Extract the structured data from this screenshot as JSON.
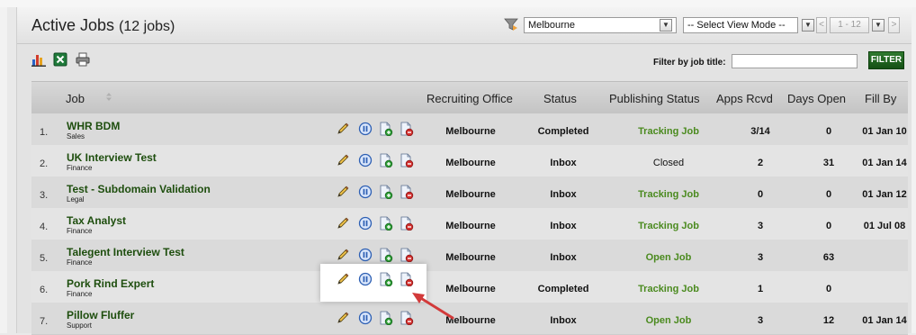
{
  "header": {
    "title": "Active Jobs",
    "count": "(12 jobs)"
  },
  "office_filter": {
    "selected": "Melbourne"
  },
  "view_mode": {
    "selected": "-- Select View Mode --"
  },
  "pager": {
    "prev": "<",
    "range": "1 - 12",
    "next": ">"
  },
  "filter": {
    "label": "Filter by job title:",
    "value": "",
    "button": "FILTER"
  },
  "columns": {
    "job": "Job",
    "office": "Recruiting Office",
    "status": "Status",
    "publishing": "Publishing Status",
    "apps": "Apps Rcvd",
    "days": "Days Open",
    "fill": "Fill By"
  },
  "rows": [
    {
      "num": "1.",
      "title": "WHR BDM",
      "dept": "Sales",
      "office": "Melbourne",
      "status": "Completed",
      "publishing": "Tracking Job",
      "apps": "3/14",
      "days": "0",
      "fill": "01 Jan 10"
    },
    {
      "num": "2.",
      "title": "UK Interview Test",
      "dept": "Finance",
      "office": "Melbourne",
      "status": "Inbox",
      "publishing": "Closed",
      "apps": "2",
      "days": "31",
      "fill": "01 Jan 14"
    },
    {
      "num": "3.",
      "title": "Test - Subdomain Validation",
      "dept": "Legal",
      "office": "Melbourne",
      "status": "Inbox",
      "publishing": "Tracking Job",
      "apps": "0",
      "days": "0",
      "fill": "01 Jan 12"
    },
    {
      "num": "4.",
      "title": "Tax Analyst",
      "dept": "Finance",
      "office": "Melbourne",
      "status": "Inbox",
      "publishing": "Tracking Job",
      "apps": "3",
      "days": "0",
      "fill": "01 Jul 08"
    },
    {
      "num": "5.",
      "title": "Talegent Interview Test",
      "dept": "Finance",
      "office": "Melbourne",
      "status": "Inbox",
      "publishing": "Open Job",
      "apps": "3",
      "days": "63",
      "fill": ""
    },
    {
      "num": "6.",
      "title": "Pork Rind Expert",
      "dept": "Finance",
      "office": "Melbourne",
      "status": "Completed",
      "publishing": "Tracking Job",
      "apps": "1",
      "days": "0",
      "fill": ""
    },
    {
      "num": "7.",
      "title": "Pillow Fluffer",
      "dept": "Support",
      "office": "Melbourne",
      "status": "Inbox",
      "publishing": "Open Job",
      "apps": "3",
      "days": "12",
      "fill": "01 Jan 14"
    }
  ],
  "colors": {
    "job_title": "#1e4e0e",
    "publishing_active": "#4a8a1e",
    "filter_button": "#1f6a1f",
    "callout_arrow": "#d23a3a"
  },
  "icons": {
    "toolbar": [
      "bar-chart-icon",
      "excel-export-icon",
      "print-icon"
    ],
    "row_actions": [
      "edit-pencil-icon",
      "pause-icon",
      "publish-document-icon",
      "unpublish-document-icon"
    ]
  }
}
